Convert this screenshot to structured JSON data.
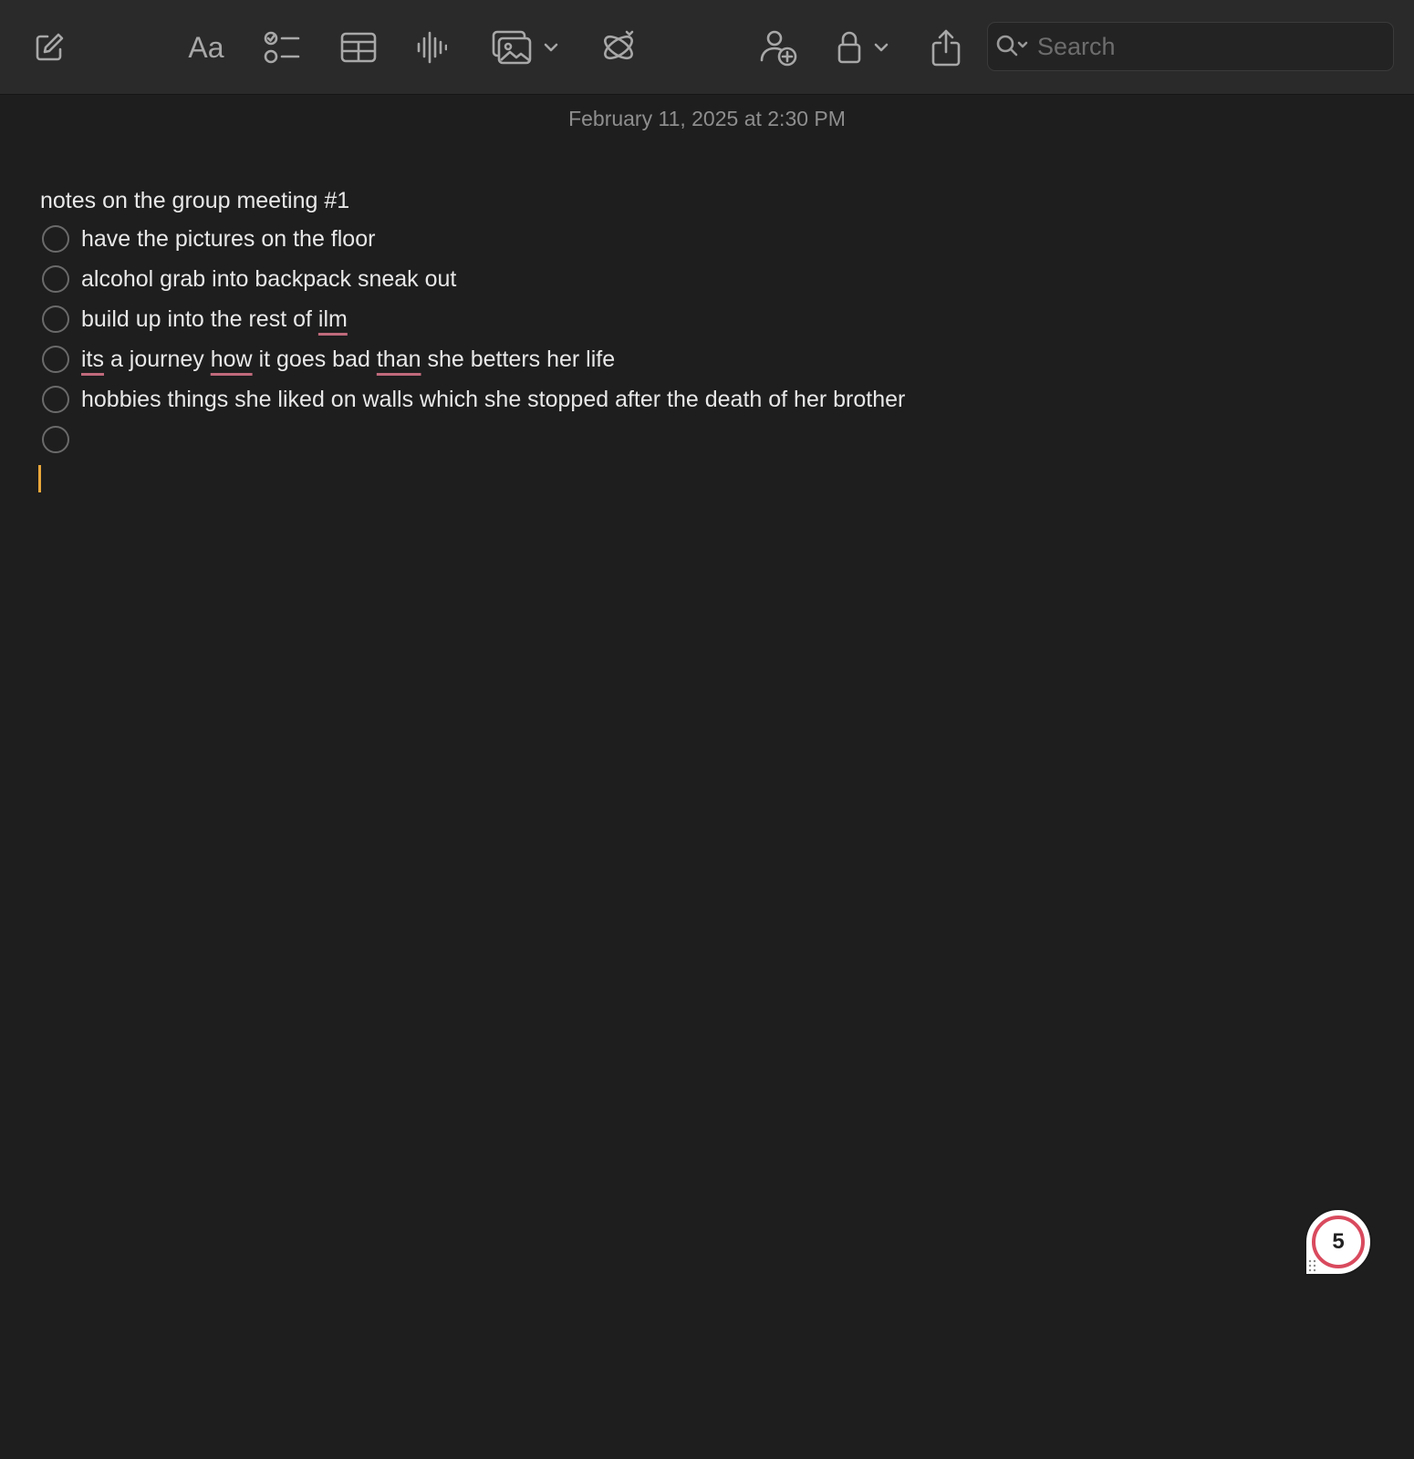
{
  "toolbar": {
    "new_note_icon": "compose-icon",
    "format_label": "Aa",
    "checklist_icon": "checklist-icon",
    "table_icon": "table-icon",
    "audio_icon": "waveform-icon",
    "media_icon": "photo-icon",
    "media_menu_icon": "chevron-down-icon",
    "writing_tools_icon": "writing-tools-icon",
    "collaborate_icon": "collaborate-icon",
    "lock_icon": "lock-icon",
    "lock_menu_icon": "chevron-down-icon",
    "share_icon": "share-icon"
  },
  "search": {
    "placeholder": "Search",
    "value": ""
  },
  "note": {
    "timestamp": "February 11, 2025 at 2:30 PM",
    "title": "notes on the group meeting #1",
    "checklist": [
      {
        "text": "have the pictures on the floor",
        "checked": false
      },
      {
        "text": "alcohol grab into backpack sneak out",
        "checked": false
      },
      {
        "text_parts": [
          "build up into the rest of ",
          "ilm"
        ],
        "checked": false
      },
      {
        "text_parts": [
          "its",
          " a journey ",
          "how",
          " it goes bad ",
          "than",
          " she betters her life"
        ],
        "checked": false
      },
      {
        "text": "hobbies things she liked on walls which she stopped after the death of her brother",
        "checked": false
      },
      {
        "text": "",
        "checked": false
      }
    ],
    "misspelled_words": [
      "ilm",
      "its",
      "how",
      "than"
    ]
  },
  "badge": {
    "count": "5"
  },
  "colors": {
    "background": "#1e1e1e",
    "toolbar": "#2a2a2a",
    "caret": "#e9a73a",
    "spellcheck_underline": "#c06a7c",
    "badge_ring": "#d94a5e"
  }
}
